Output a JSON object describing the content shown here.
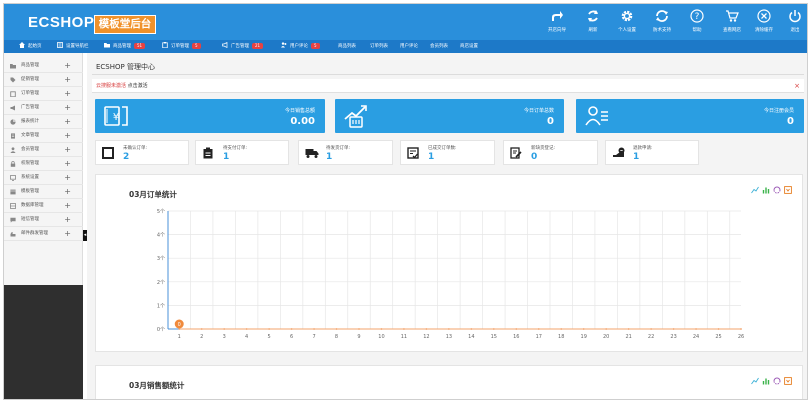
{
  "header": {
    "logo_text": "ECSHOP",
    "logo_badge": "模板堂后台",
    "tools": [
      {
        "label": "开店向导",
        "icon": "share-arrow-icon"
      },
      {
        "label": "刷新",
        "icon": "refresh-icon"
      },
      {
        "label": "个人设置",
        "icon": "gear-icon"
      },
      {
        "label": "防术支持",
        "icon": "sync-icon"
      },
      {
        "label": "帮助",
        "icon": "help-icon"
      },
      {
        "label": "查看网店",
        "icon": "cart-icon"
      },
      {
        "label": "清除缓存",
        "icon": "clear-icon"
      },
      {
        "label": "退出",
        "icon": "power-icon"
      }
    ]
  },
  "nav": {
    "items": [
      {
        "label": "起始页",
        "icon": "home-icon"
      },
      {
        "label": "设置导航栏",
        "icon": "settings-icon"
      },
      {
        "label": "商品管理",
        "icon": "folder-icon",
        "badge": "51"
      },
      {
        "label": "订单管理",
        "icon": "clipboard-icon",
        "badge": "5"
      },
      {
        "label": "广告管理",
        "icon": "megaphone-icon",
        "badge": "21"
      },
      {
        "label": "用户评论",
        "icon": "users-icon",
        "badge": "5"
      },
      {
        "label": "商品列表"
      },
      {
        "label": "订单列表"
      },
      {
        "label": "用户评论"
      },
      {
        "label": "会员列表"
      },
      {
        "label": "商店设置"
      }
    ]
  },
  "sidebar": {
    "items": [
      {
        "label": "商品管理",
        "icon": "folder-icon"
      },
      {
        "label": "促销管理",
        "icon": "tag-icon"
      },
      {
        "label": "订单管理",
        "icon": "clipboard-icon"
      },
      {
        "label": "广告管理",
        "icon": "megaphone-icon"
      },
      {
        "label": "报表统计",
        "icon": "chart-icon"
      },
      {
        "label": "文章管理",
        "icon": "document-icon"
      },
      {
        "label": "会员管理",
        "icon": "user-icon"
      },
      {
        "label": "权限管理",
        "icon": "lock-icon"
      },
      {
        "label": "系统设置",
        "icon": "monitor-icon"
      },
      {
        "label": "模板管理",
        "icon": "template-icon"
      },
      {
        "label": "数据库管理",
        "icon": "database-icon"
      },
      {
        "label": "短信管理",
        "icon": "message-icon"
      },
      {
        "label": "邮件群发管理",
        "icon": "mail-icon"
      }
    ]
  },
  "main": {
    "title": "ECSHOP 管理中心",
    "alert": {
      "warning": "云搜服未激活",
      "action": "点击激活"
    },
    "stats": [
      {
        "label": "今日销售总额",
        "value": "0.00",
        "icon": "money-icon"
      },
      {
        "label": "今日订单总数",
        "value": "0",
        "icon": "growth-icon"
      },
      {
        "label": "今日注册会员",
        "value": "0",
        "icon": "member-card-icon"
      }
    ],
    "mini_stats": [
      {
        "label": "未确认订单:",
        "value": "2",
        "icon": "square-icon"
      },
      {
        "label": "待支付订单:",
        "value": "1",
        "icon": "wallet-icon"
      },
      {
        "label": "待发货订单:",
        "value": "1",
        "icon": "truck-icon"
      },
      {
        "label": "已成交订单数:",
        "value": "1",
        "icon": "check-list-icon"
      },
      {
        "label": "新缺货登记:",
        "value": "0",
        "icon": "edit-icon"
      },
      {
        "label": "退款申请:",
        "value": "1",
        "icon": "refund-icon"
      }
    ],
    "panels": [
      {
        "title": "03月订单统计"
      },
      {
        "title": "03月销售额统计"
      }
    ]
  },
  "chart_data": {
    "type": "line",
    "title": "03月订单统计",
    "x": [
      1,
      2,
      3,
      4,
      5,
      6,
      7,
      8,
      9,
      10,
      11,
      12,
      13,
      14,
      15,
      16,
      17,
      18,
      19,
      20,
      21,
      22,
      23,
      24,
      25,
      26
    ],
    "y_tick_labels": [
      "0个",
      "1个",
      "2个",
      "3个",
      "4个",
      "5个"
    ],
    "ylim": [
      0,
      5
    ],
    "series": [
      {
        "values": [
          0,
          0,
          0,
          0,
          0,
          0,
          0,
          0,
          0,
          0,
          0,
          0,
          0,
          0,
          0,
          0,
          0,
          0,
          0,
          0,
          0,
          0,
          0,
          0,
          0,
          0
        ]
      }
    ],
    "grid": true,
    "highlight": {
      "x": 1,
      "label": "0"
    },
    "line_color": "#f3a36b",
    "highlight_color": "#f08a3c"
  }
}
